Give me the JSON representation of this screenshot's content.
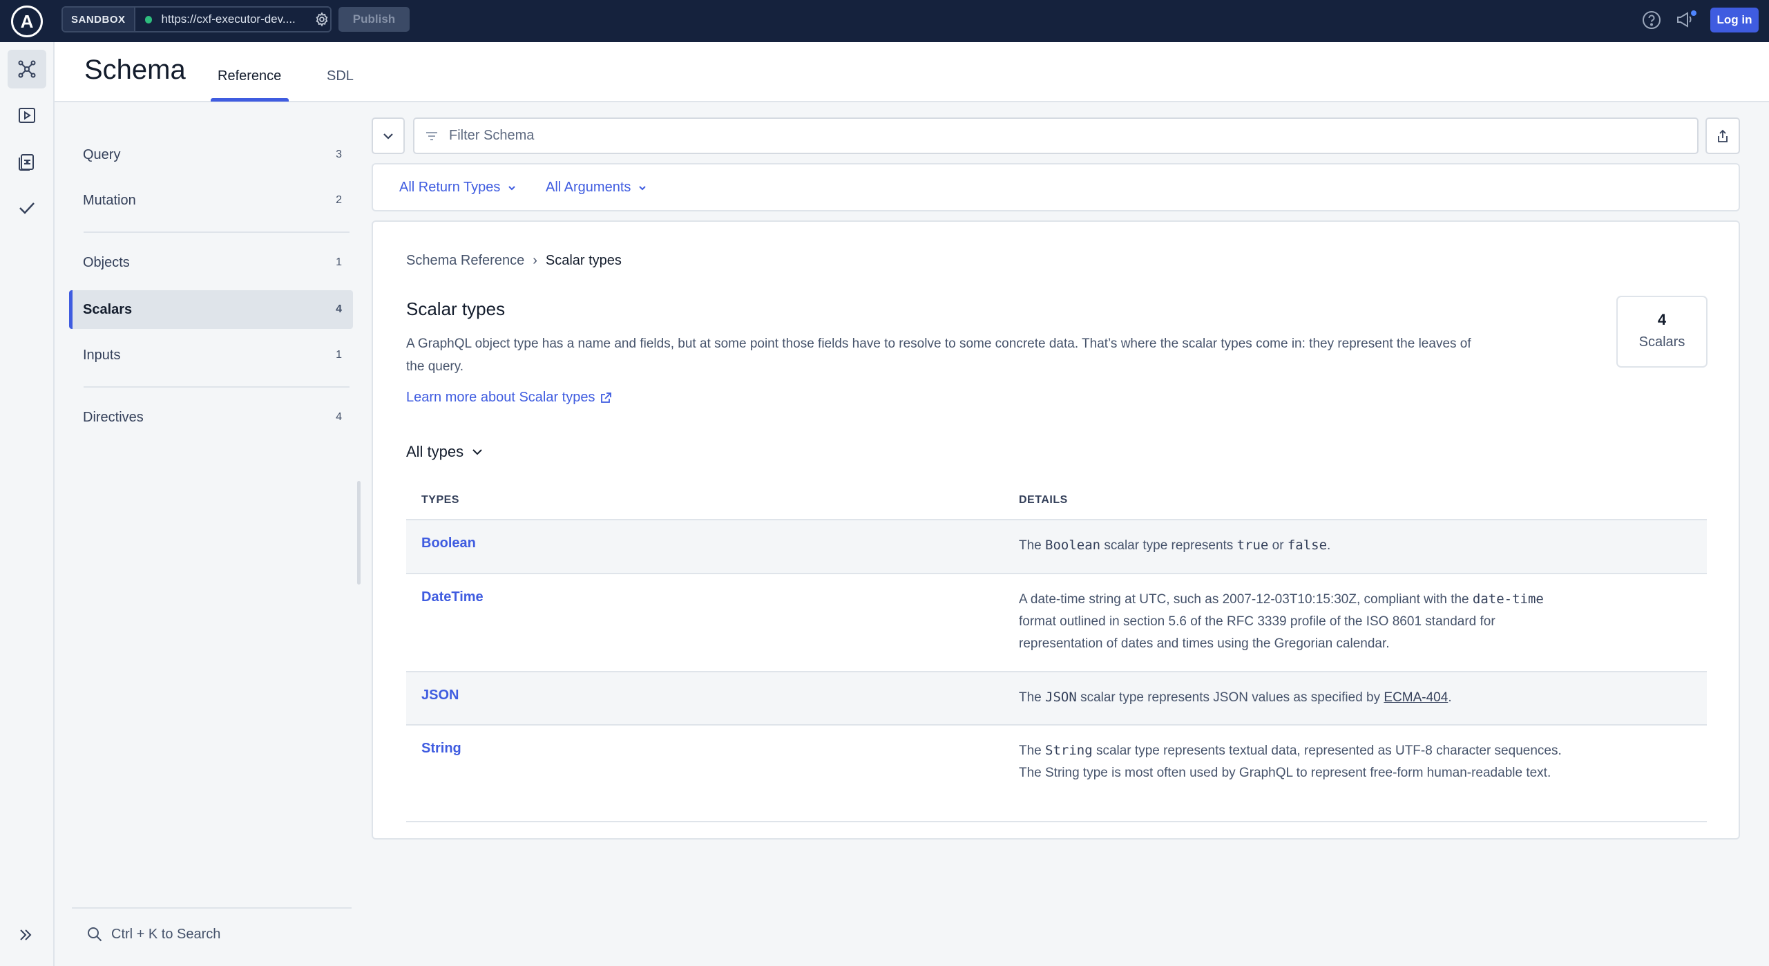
{
  "topbar": {
    "logo_letter": "A",
    "sandbox_label": "SANDBOX",
    "endpoint_url": "https://cxf-executor-dev....",
    "publish_label": "Publish",
    "login_label": "Log in",
    "accent_color": "#3f5ce0",
    "status_color": "#2ebd7e"
  },
  "rail": {
    "items": [
      {
        "icon": "schema-graph-icon",
        "active": true
      },
      {
        "icon": "explorer-play-icon",
        "active": false
      },
      {
        "icon": "checks-clipboard-icon",
        "active": false
      },
      {
        "icon": "checkmark-icon",
        "active": false
      }
    ],
    "expand_icon": "double-chevron-right-icon"
  },
  "header": {
    "title": "Schema",
    "tabs": [
      {
        "label": "Reference",
        "active": true
      },
      {
        "label": "SDL",
        "active": false
      }
    ]
  },
  "sidebar": {
    "items": [
      {
        "label": "Query",
        "count": "3"
      },
      {
        "label": "Mutation",
        "count": "2"
      },
      {
        "label": "Objects",
        "count": "1"
      },
      {
        "label": "Scalars",
        "count": "4",
        "active": true
      },
      {
        "label": "Inputs",
        "count": "1"
      },
      {
        "label": "Directives",
        "count": "4"
      }
    ],
    "search_hint": "Ctrl + K to Search"
  },
  "filter": {
    "placeholder": "Filter Schema",
    "return_types_label": "All Return Types",
    "arguments_label": "All Arguments"
  },
  "content": {
    "breadcrumb": {
      "parent": "Schema Reference",
      "separator": "›",
      "current": "Scalar types"
    },
    "title": "Scalar types",
    "description": "A GraphQL object type has a name and fields, but at some point those fields have to resolve to some concrete data. That’s where the scalar types come in: they represent the leaves of the query.",
    "learn_more": "Learn more about Scalar types",
    "count_number": "4",
    "count_label": "Scalars",
    "all_types_label": "All types",
    "table": {
      "col_types": "TYPES",
      "col_details": "DETAILS",
      "rows": [
        {
          "name": "Boolean",
          "d1": "The ",
          "m1": "Boolean",
          "d2": " scalar type represents ",
          "m2": "true",
          "d3": " or ",
          "m3": "false",
          "d4": "."
        },
        {
          "name": "DateTime",
          "d1": "A date-time string at UTC, such as 2007-12-03T10:15:30Z, compliant with the ",
          "m1": "date-time",
          "d2": " format outlined in section 5.6 of the RFC 3339 profile of the ISO 8601 standard for representation of dates and times using the Gregorian calendar."
        },
        {
          "name": "JSON",
          "d1": "The ",
          "m1": "JSON",
          "d2": " scalar type represents JSON values as specified by ",
          "link": "ECMA-404",
          "d3": "."
        },
        {
          "name": "String",
          "d1": "The ",
          "m1": "String",
          "d2": " scalar type represents textual data, represented as UTF-8 character sequences. The String type is most often used by GraphQL to represent free-form human-readable text."
        }
      ]
    }
  }
}
